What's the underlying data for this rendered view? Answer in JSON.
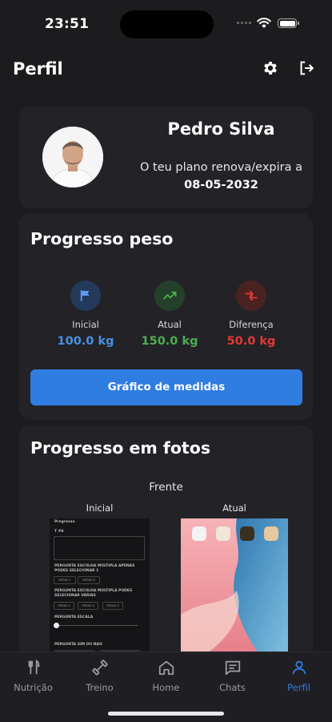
{
  "status_bar": {
    "time": "23:51"
  },
  "header": {
    "title": "Perfil",
    "settings_icon": "gear-icon",
    "logout_icon": "logout-icon"
  },
  "profile": {
    "name": "Pedro Silva",
    "plan_text": "O teu plano renova/expira a",
    "plan_date": "08-05-2032"
  },
  "weight_progress": {
    "title": "Progresso peso",
    "stats": [
      {
        "label": "Inicial",
        "value": "100.0 kg",
        "color": "#4a90e2",
        "icon": "flag-icon"
      },
      {
        "label": "Atual",
        "value": "150.0 kg",
        "color": "#4caf50",
        "icon": "trending-up-icon"
      },
      {
        "label": "Diferença",
        "value": "50.0 kg",
        "color": "#e53935",
        "icon": "compare-arrows-icon"
      }
    ],
    "button_label": "Gráfico de medidas"
  },
  "photo_progress": {
    "title": "Progresso em fotos",
    "view_label": "Frente",
    "columns": [
      {
        "label": "Inicial"
      },
      {
        "label": "Atual"
      }
    ],
    "initial_photo_lines": [
      "Progresso",
      "T #8",
      "PERGUNTA ESCOLHA MULTIPLA APENAS PODES SELECIONAR 1",
      "OPCAO 1",
      "OPCAO 2",
      "PERGUNTA ESCOLHA MULTIPLA PODES SELECIONAR VARIAS",
      "OPCAO 1",
      "OPCAO 2",
      "OPCAO 3",
      "PERGUNTA ESCALA",
      "PERGUNTA SIM OU NAO"
    ]
  },
  "tab_bar": {
    "tabs": [
      {
        "label": "Nutrição",
        "icon": "fork-knife-icon",
        "active": false
      },
      {
        "label": "Treino",
        "icon": "dumbbell-icon",
        "active": false
      },
      {
        "label": "Home",
        "icon": "home-icon",
        "active": false
      },
      {
        "label": "Chats",
        "icon": "chat-icon",
        "active": false
      },
      {
        "label": "Perfil",
        "icon": "person-icon",
        "active": true
      }
    ]
  },
  "colors": {
    "accent": "#2f7de1",
    "background": "#1c1c1f",
    "card": "#232327"
  }
}
